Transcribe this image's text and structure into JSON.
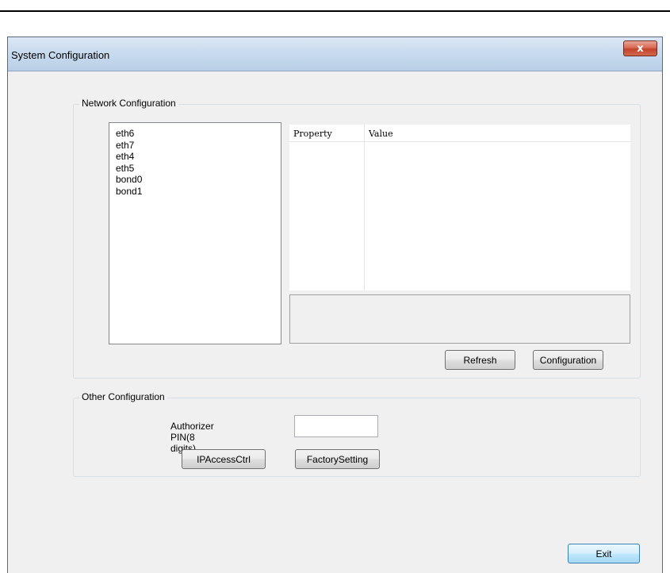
{
  "window": {
    "title": "System Configuration",
    "close_glyph": "x",
    "close_icon": "close-icon"
  },
  "network_group": {
    "legend": "Network Configuration",
    "interfaces": [
      "eth6",
      "eth7",
      "eth4",
      "eth5",
      "bond0",
      "bond1"
    ],
    "property_table": {
      "columns": [
        "Property",
        "Value"
      ],
      "rows": []
    },
    "refresh_label": "Refresh",
    "configuration_label": "Configuration"
  },
  "other_group": {
    "legend": "Other Configuration",
    "pin_label": "Authorizer PIN(8 digits)",
    "pin_value": "",
    "ipaccess_label": "IPAccessCtrl",
    "factory_label": "FactorySetting"
  },
  "exit_label": "Exit",
  "colors": {
    "title_bar": "#c9dbee",
    "close_button": "#c3432a",
    "window_bg": "#f0f0f0",
    "exit_border": "#3c7fb1"
  }
}
